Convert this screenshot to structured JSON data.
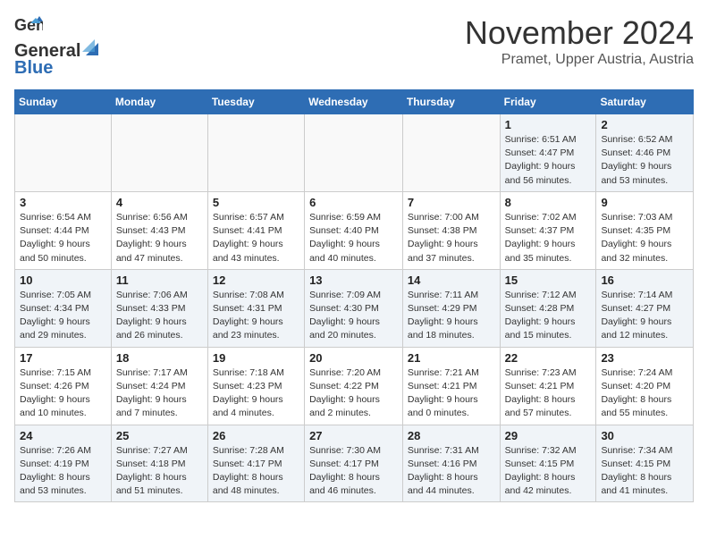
{
  "logo": {
    "line1": "General",
    "line2": "Blue"
  },
  "title": "November 2024",
  "location": "Pramet, Upper Austria, Austria",
  "days_header": [
    "Sunday",
    "Monday",
    "Tuesday",
    "Wednesday",
    "Thursday",
    "Friday",
    "Saturday"
  ],
  "weeks": [
    [
      {
        "num": "",
        "info": ""
      },
      {
        "num": "",
        "info": ""
      },
      {
        "num": "",
        "info": ""
      },
      {
        "num": "",
        "info": ""
      },
      {
        "num": "",
        "info": ""
      },
      {
        "num": "1",
        "info": "Sunrise: 6:51 AM\nSunset: 4:47 PM\nDaylight: 9 hours and 56 minutes."
      },
      {
        "num": "2",
        "info": "Sunrise: 6:52 AM\nSunset: 4:46 PM\nDaylight: 9 hours and 53 minutes."
      }
    ],
    [
      {
        "num": "3",
        "info": "Sunrise: 6:54 AM\nSunset: 4:44 PM\nDaylight: 9 hours and 50 minutes."
      },
      {
        "num": "4",
        "info": "Sunrise: 6:56 AM\nSunset: 4:43 PM\nDaylight: 9 hours and 47 minutes."
      },
      {
        "num": "5",
        "info": "Sunrise: 6:57 AM\nSunset: 4:41 PM\nDaylight: 9 hours and 43 minutes."
      },
      {
        "num": "6",
        "info": "Sunrise: 6:59 AM\nSunset: 4:40 PM\nDaylight: 9 hours and 40 minutes."
      },
      {
        "num": "7",
        "info": "Sunrise: 7:00 AM\nSunset: 4:38 PM\nDaylight: 9 hours and 37 minutes."
      },
      {
        "num": "8",
        "info": "Sunrise: 7:02 AM\nSunset: 4:37 PM\nDaylight: 9 hours and 35 minutes."
      },
      {
        "num": "9",
        "info": "Sunrise: 7:03 AM\nSunset: 4:35 PM\nDaylight: 9 hours and 32 minutes."
      }
    ],
    [
      {
        "num": "10",
        "info": "Sunrise: 7:05 AM\nSunset: 4:34 PM\nDaylight: 9 hours and 29 minutes."
      },
      {
        "num": "11",
        "info": "Sunrise: 7:06 AM\nSunset: 4:33 PM\nDaylight: 9 hours and 26 minutes."
      },
      {
        "num": "12",
        "info": "Sunrise: 7:08 AM\nSunset: 4:31 PM\nDaylight: 9 hours and 23 minutes."
      },
      {
        "num": "13",
        "info": "Sunrise: 7:09 AM\nSunset: 4:30 PM\nDaylight: 9 hours and 20 minutes."
      },
      {
        "num": "14",
        "info": "Sunrise: 7:11 AM\nSunset: 4:29 PM\nDaylight: 9 hours and 18 minutes."
      },
      {
        "num": "15",
        "info": "Sunrise: 7:12 AM\nSunset: 4:28 PM\nDaylight: 9 hours and 15 minutes."
      },
      {
        "num": "16",
        "info": "Sunrise: 7:14 AM\nSunset: 4:27 PM\nDaylight: 9 hours and 12 minutes."
      }
    ],
    [
      {
        "num": "17",
        "info": "Sunrise: 7:15 AM\nSunset: 4:26 PM\nDaylight: 9 hours and 10 minutes."
      },
      {
        "num": "18",
        "info": "Sunrise: 7:17 AM\nSunset: 4:24 PM\nDaylight: 9 hours and 7 minutes."
      },
      {
        "num": "19",
        "info": "Sunrise: 7:18 AM\nSunset: 4:23 PM\nDaylight: 9 hours and 4 minutes."
      },
      {
        "num": "20",
        "info": "Sunrise: 7:20 AM\nSunset: 4:22 PM\nDaylight: 9 hours and 2 minutes."
      },
      {
        "num": "21",
        "info": "Sunrise: 7:21 AM\nSunset: 4:21 PM\nDaylight: 9 hours and 0 minutes."
      },
      {
        "num": "22",
        "info": "Sunrise: 7:23 AM\nSunset: 4:21 PM\nDaylight: 8 hours and 57 minutes."
      },
      {
        "num": "23",
        "info": "Sunrise: 7:24 AM\nSunset: 4:20 PM\nDaylight: 8 hours and 55 minutes."
      }
    ],
    [
      {
        "num": "24",
        "info": "Sunrise: 7:26 AM\nSunset: 4:19 PM\nDaylight: 8 hours and 53 minutes."
      },
      {
        "num": "25",
        "info": "Sunrise: 7:27 AM\nSunset: 4:18 PM\nDaylight: 8 hours and 51 minutes."
      },
      {
        "num": "26",
        "info": "Sunrise: 7:28 AM\nSunset: 4:17 PM\nDaylight: 8 hours and 48 minutes."
      },
      {
        "num": "27",
        "info": "Sunrise: 7:30 AM\nSunset: 4:17 PM\nDaylight: 8 hours and 46 minutes."
      },
      {
        "num": "28",
        "info": "Sunrise: 7:31 AM\nSunset: 4:16 PM\nDaylight: 8 hours and 44 minutes."
      },
      {
        "num": "29",
        "info": "Sunrise: 7:32 AM\nSunset: 4:15 PM\nDaylight: 8 hours and 42 minutes."
      },
      {
        "num": "30",
        "info": "Sunrise: 7:34 AM\nSunset: 4:15 PM\nDaylight: 8 hours and 41 minutes."
      }
    ]
  ]
}
